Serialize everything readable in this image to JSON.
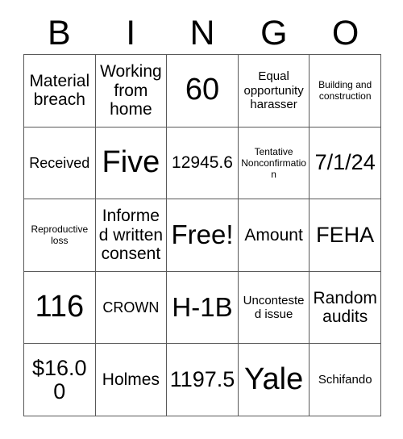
{
  "card": {
    "header_letters": [
      "B",
      "I",
      "N",
      "G",
      "O"
    ],
    "free_space_label": "Free!",
    "border_color": "#595959",
    "background_color": "#ffffff",
    "text_color": "#000000",
    "rows": [
      [
        {
          "text": "Material breach",
          "size": "md"
        },
        {
          "text": "Working from home",
          "size": "md"
        },
        {
          "text": "60",
          "size": "xxl"
        },
        {
          "text": "Equal opportunity harasser",
          "size": "xs"
        },
        {
          "text": "Building and construction",
          "size": "xxs"
        }
      ],
      [
        {
          "text": "Received",
          "size": "sm"
        },
        {
          "text": "Five",
          "size": "xxl"
        },
        {
          "text": "12945.6",
          "size": "md"
        },
        {
          "text": "Tentative Nonconfirmation",
          "size": "xxs"
        },
        {
          "text": "7/1/24",
          "size": "lg"
        }
      ],
      [
        {
          "text": "Reproductive loss",
          "size": "xxs"
        },
        {
          "text": "Informed written consent",
          "size": "md"
        },
        {
          "text": "Free!",
          "size": "xl"
        },
        {
          "text": "Amount",
          "size": "md"
        },
        {
          "text": "FEHA",
          "size": "lg"
        }
      ],
      [
        {
          "text": "116",
          "size": "xxl"
        },
        {
          "text": "CROWN",
          "size": "sm"
        },
        {
          "text": "H-1B",
          "size": "xl"
        },
        {
          "text": "Uncontested issue",
          "size": "xs"
        },
        {
          "text": "Random audits",
          "size": "md"
        }
      ],
      [
        {
          "text": "$16.00",
          "size": "lg"
        },
        {
          "text": "Holmes",
          "size": "md"
        },
        {
          "text": "1197.5",
          "size": "lg"
        },
        {
          "text": "Yale",
          "size": "xxl"
        },
        {
          "text": "Schifando",
          "size": "xs"
        }
      ]
    ]
  }
}
